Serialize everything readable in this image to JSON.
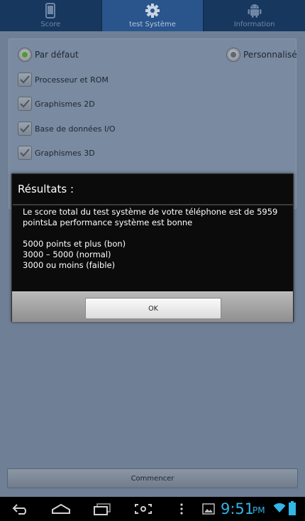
{
  "tabs": [
    {
      "label": "Score",
      "icon": "phone-icon"
    },
    {
      "label": "test Système",
      "icon": "gear-icon"
    },
    {
      "label": "Information",
      "icon": "android-icon"
    }
  ],
  "options": {
    "default_label": "Par défaut",
    "custom_label": "Personnalisé",
    "selected": "default"
  },
  "tests": [
    {
      "label": "Processeur et ROM",
      "checked": true
    },
    {
      "label": "Graphismes 2D",
      "checked": true
    },
    {
      "label": "Base de données I/O",
      "checked": true
    },
    {
      "label": "Graphismes 3D",
      "checked": true
    }
  ],
  "dialog": {
    "title": "Résultats :",
    "message": "Le score total du test système de votre téléphone est de 5959 pointsLa performance système est bonne\n\n5000 points et plus (bon)\n3000 – 5000 (normal)\n3000 ou moins (faible)",
    "ok_label": "OK"
  },
  "start_label": "Commencer",
  "statusbar": {
    "time": "9:51",
    "ampm": "PM"
  },
  "colors": {
    "tab_bar": "#17375e",
    "tab_active": "#2a558c",
    "clock": "#33b5e5",
    "radio_selected": "#4e9a2e"
  }
}
